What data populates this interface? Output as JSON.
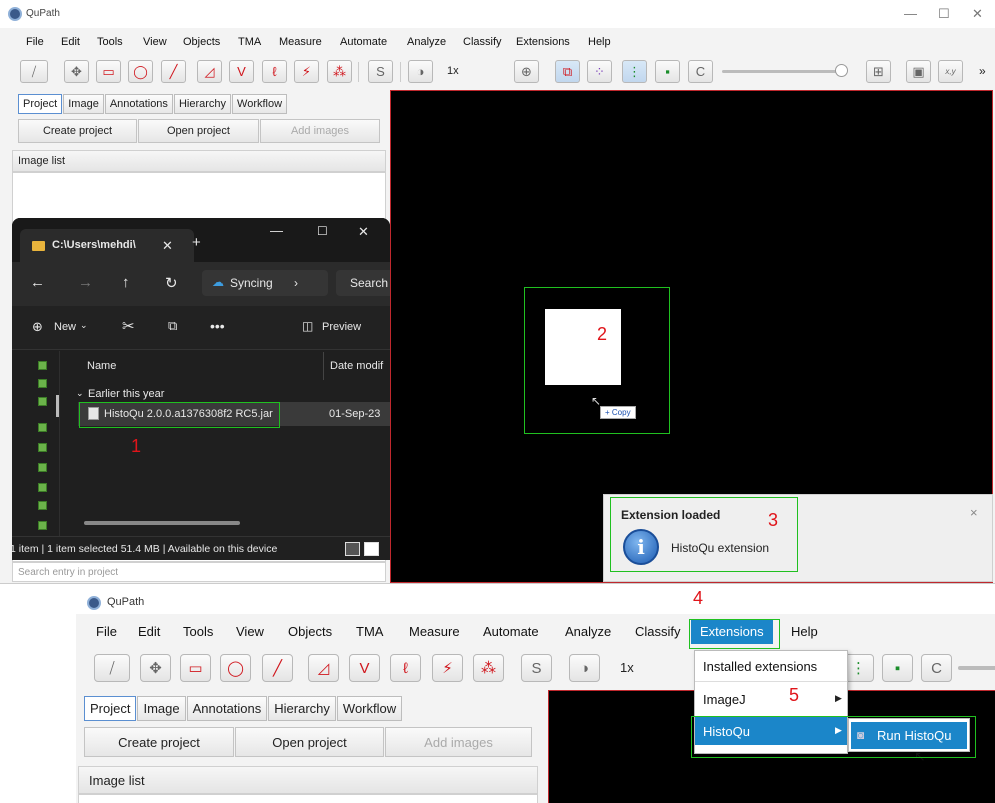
{
  "top": {
    "title": "QuPath",
    "menu": [
      "File",
      "Edit",
      "Tools",
      "View",
      "Objects",
      "TMA",
      "Measure",
      "Automate",
      "Analyze",
      "Classify",
      "Extensions",
      "Help"
    ],
    "zoom": "1x",
    "slider_label": "x,y",
    "tabs": [
      "Project",
      "Image",
      "Annotations",
      "Hierarchy",
      "Workflow"
    ],
    "buttons": {
      "create": "Create project",
      "open": "Open project",
      "add": "Add images"
    },
    "image_list": "Image list",
    "search_placeholder": "Search entry in project",
    "more": "»"
  },
  "explorer": {
    "tab_title": "C:\\Users\\mehdi\\",
    "syncing": "Syncing",
    "search": "Search",
    "new": "New",
    "preview": "Preview",
    "col_name": "Name",
    "col_date": "Date modif",
    "group": "Earlier this year",
    "file_name": "HistoQu 2.0.0.a1376308f2 RC5.jar",
    "file_date": "01-Sep-23",
    "status": "1 item  |  1 item selected  51.4 MB  |  Available on this device"
  },
  "drag": {
    "copy": "+ Copy"
  },
  "notification": {
    "title": "Extension loaded",
    "message": "HistoQu extension",
    "close": "×"
  },
  "steps": [
    "1",
    "2",
    "3",
    "4",
    "5"
  ],
  "bottom": {
    "title": "QuPath",
    "menu": [
      "File",
      "Edit",
      "Tools",
      "View",
      "Objects",
      "TMA",
      "Measure",
      "Automate",
      "Analyze",
      "Classify",
      "Extensions",
      "Help"
    ],
    "zoom": "1x",
    "tabs": [
      "Project",
      "Image",
      "Annotations",
      "Hierarchy",
      "Workflow"
    ],
    "buttons": {
      "create": "Create project",
      "open": "Open project",
      "add": "Add images"
    },
    "image_list": "Image list",
    "ext_menu": [
      "Installed extensions",
      "ImageJ",
      "HistoQu"
    ],
    "submenu": "Run HistoQu"
  },
  "colors": {
    "accent": "#1b86c9",
    "highlight": "#20c020",
    "step_number": "#e0141a",
    "tool_red": "#d0161d"
  }
}
